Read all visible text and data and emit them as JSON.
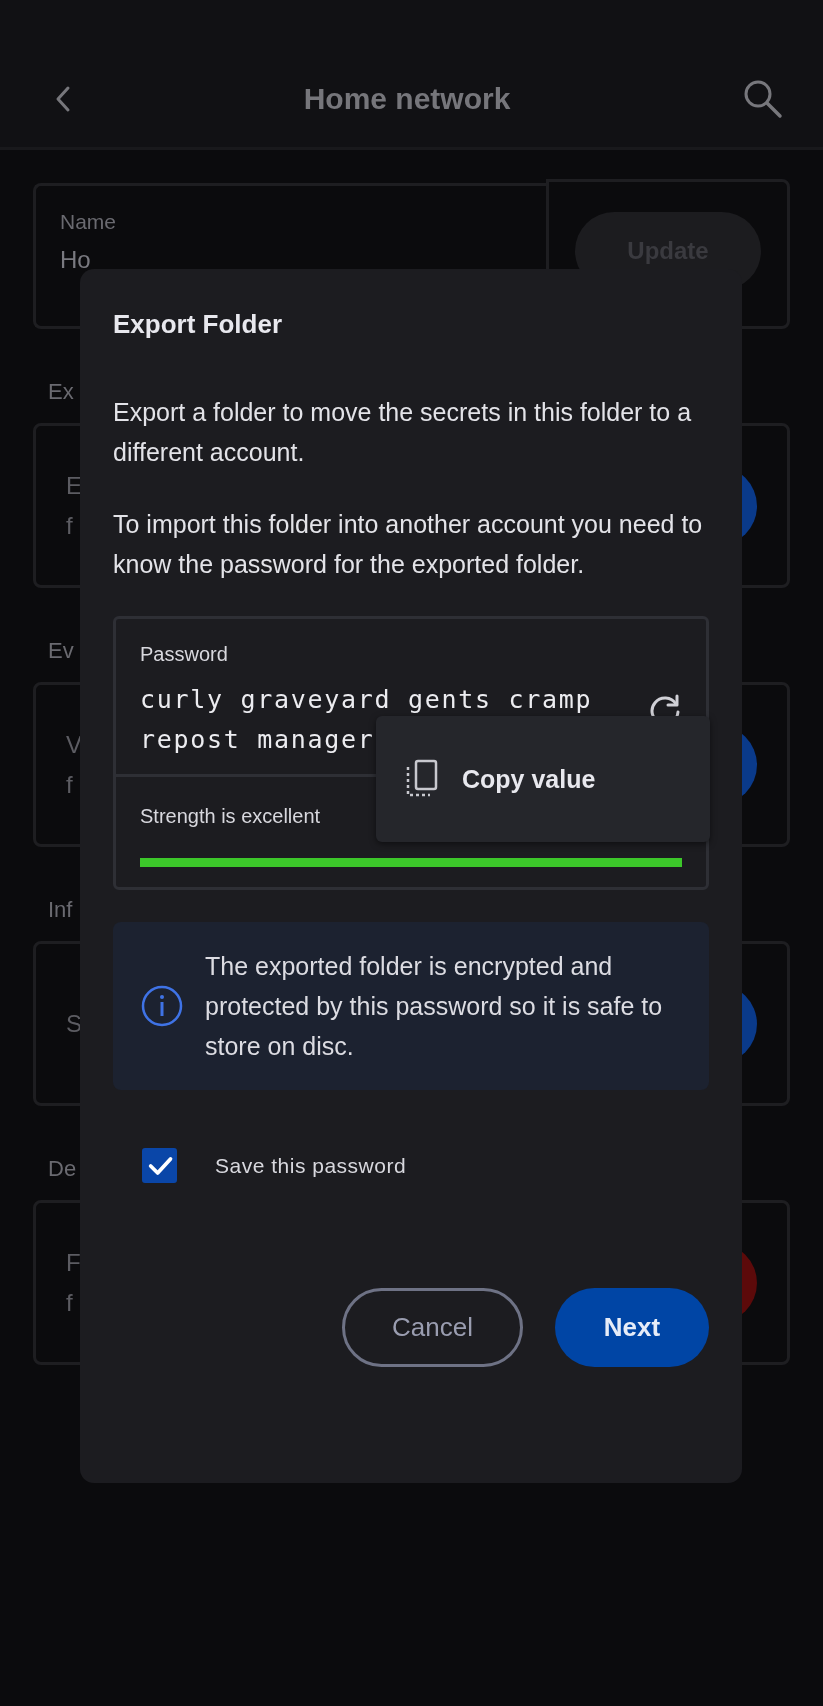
{
  "header": {
    "title": "Home network"
  },
  "name_field": {
    "label": "Name",
    "value": "Ho"
  },
  "update_button": {
    "label": "Update",
    "disabled": true
  },
  "sections": [
    {
      "heading": "Ex",
      "lines": [
        "E",
        "f"
      ],
      "color": "#0a3a8a"
    },
    {
      "heading": "Ev",
      "lines": [
        "V",
        "f"
      ],
      "color": "#0a3a8a"
    },
    {
      "heading": "Inf",
      "lines": [
        "S"
      ],
      "color": "#0a3a8a"
    },
    {
      "heading": "De",
      "lines": [
        "F",
        "f"
      ],
      "color": "#5c0a0a"
    }
  ],
  "dialog": {
    "title": "Export Folder",
    "paragraphs": [
      "Export a folder to move the secrets in this folder to a different account.",
      "To import this folder into another account you need to know the password for the exported folder."
    ],
    "password": {
      "label": "Password",
      "value": "curly graveyard gents cramp repost manager",
      "strength_label": "Strength is excellent",
      "level": 1
    },
    "context_menu": {
      "items": [
        {
          "label": "Copy value"
        }
      ]
    },
    "info": "The exported folder is encrypted and protected by this password so it is safe to store on disc.",
    "save_password": {
      "label": "Save this password",
      "checked": true
    },
    "buttons": [
      {
        "label": "Cancel",
        "kind": "outlined"
      },
      {
        "label": "Next",
        "kind": "filled"
      }
    ]
  }
}
